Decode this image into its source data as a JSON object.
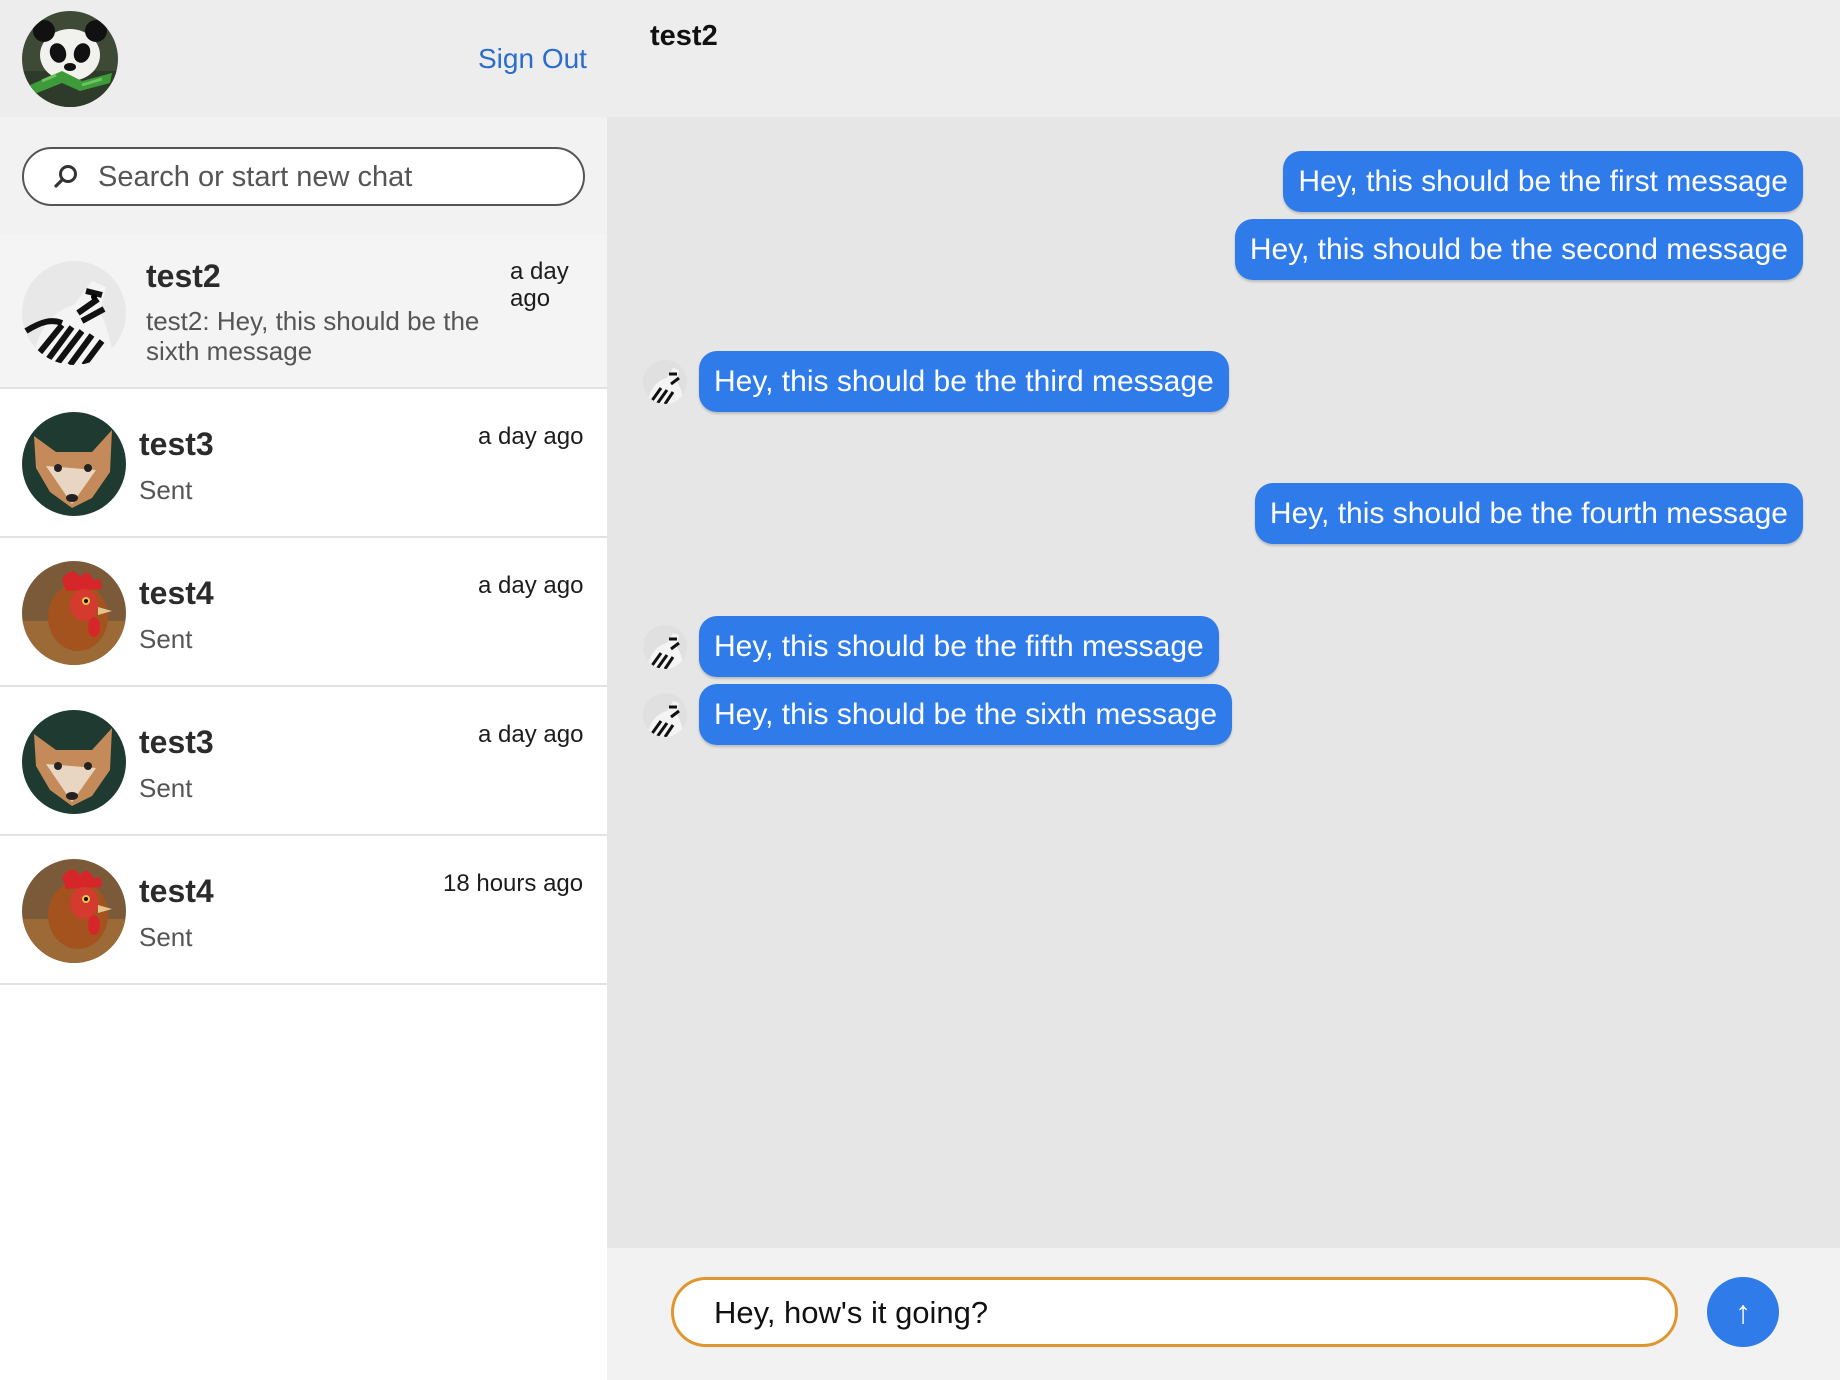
{
  "sidebar": {
    "user_avatar": "panda-avatar",
    "sign_out_label": "Sign Out",
    "search": {
      "placeholder": "Search or start new chat"
    },
    "chats": [
      {
        "name": "test2",
        "preview": "test2: Hey, this should be the sixth message",
        "time": "a day ago",
        "avatar": "zebra-avatar",
        "active": true
      },
      {
        "name": "test3",
        "preview": "Sent",
        "time": "a day ago",
        "avatar": "fox-avatar",
        "active": false
      },
      {
        "name": "test4",
        "preview": "Sent",
        "time": "a day ago",
        "avatar": "rooster-avatar",
        "active": false
      },
      {
        "name": "test3",
        "preview": "Sent",
        "time": "a day ago",
        "avatar": "fox-avatar",
        "active": false
      },
      {
        "name": "test4",
        "preview": "Sent",
        "time": "18 hours ago",
        "avatar": "rooster-avatar",
        "active": false
      }
    ]
  },
  "conversation": {
    "title": "test2",
    "messages": [
      {
        "text": "Hey, this should be the first message",
        "direction": "outgoing"
      },
      {
        "text": "Hey, this should be the second message",
        "direction": "outgoing"
      },
      {
        "text": "Hey, this should be the third message",
        "direction": "incoming",
        "avatar": "zebra-avatar"
      },
      {
        "text": "Hey, this should be the fourth message",
        "direction": "outgoing"
      },
      {
        "text": "Hey, this should be the fifth message",
        "direction": "incoming",
        "avatar": "zebra-avatar"
      },
      {
        "text": "Hey, this should be the sixth message",
        "direction": "incoming",
        "avatar": "zebra-avatar"
      }
    ]
  },
  "composer": {
    "value": "Hey, how's it going?",
    "send_icon": "↑"
  },
  "colors": {
    "accent": "#2f7bea",
    "link": "#2a6dcc",
    "compose_border": "#e0962f"
  }
}
